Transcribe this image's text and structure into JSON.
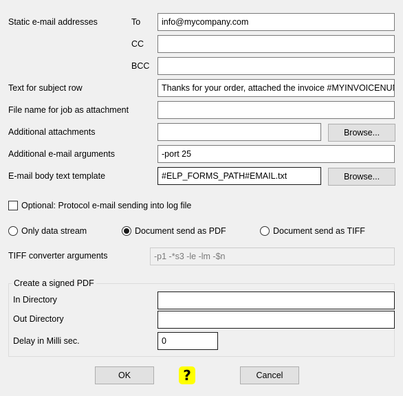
{
  "email": {
    "static_label": "Static e-mail addresses",
    "to_label": "To",
    "to_value": "info@mycompany.com",
    "cc_label": "CC",
    "cc_value": "",
    "bcc_label": "BCC",
    "bcc_value": "",
    "subject_label": "Text for subject row",
    "subject_value": "Thanks for your order, attached the invoice #MYINVOICENUMBER#",
    "filename_label": "File name for job as attachment",
    "filename_value": "",
    "attachments_label": "Additional attachments",
    "attachments_value": "",
    "args_label": "Additional e-mail arguments",
    "args_value": "-port 25",
    "template_label": "E-mail body text template",
    "template_value": "#ELP_FORMS_PATH#EMAIL.txt",
    "browse_label": "Browse..."
  },
  "protocol": {
    "label": "Optional: Protocol e-mail sending into log file",
    "checked": false
  },
  "send_mode": {
    "options": [
      "Only data stream",
      "Document send as PDF",
      "Document send as TIFF"
    ],
    "selected": "Document send as PDF"
  },
  "tiff": {
    "label": "TIFF converter arguments",
    "value": "-p1 -*s3 -le -lm -$n"
  },
  "signed_pdf": {
    "title": "Create a signed PDF",
    "in_label": "In Directory",
    "in_value": "",
    "out_label": "Out Directory",
    "out_value": "",
    "delay_label": "Delay in Milli sec.",
    "delay_value": "0"
  },
  "buttons": {
    "ok": "OK",
    "help": "?",
    "cancel": "Cancel"
  }
}
